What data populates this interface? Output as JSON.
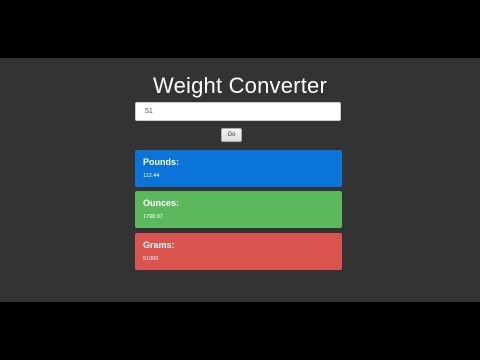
{
  "app": {
    "title": "Weight Converter"
  },
  "form": {
    "input_value": "51",
    "go_label": "Go"
  },
  "results": [
    {
      "label": "Pounds:",
      "value": "112.44",
      "color": "#0b74d8"
    },
    {
      "label": "Ounces:",
      "value": "1798.97",
      "color": "#5cb85c"
    },
    {
      "label": "Grams:",
      "value": "51000",
      "color": "#d9534f"
    }
  ]
}
